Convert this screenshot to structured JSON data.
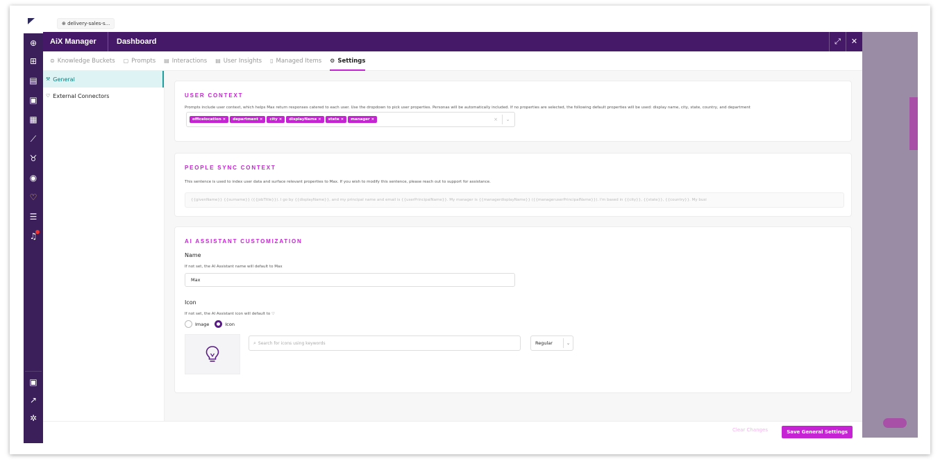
{
  "browser_tab": {
    "label": "delivery-sales-s..."
  },
  "header": {
    "brand": "AiX Manager",
    "title": "Dashboard",
    "expand_label": "⤢",
    "close_label": "✕"
  },
  "nav_tabs": [
    {
      "label": "Knowledge Buckets",
      "icon": "bucket-icon"
    },
    {
      "label": "Prompts",
      "icon": "prompt-icon"
    },
    {
      "label": "Interactions",
      "icon": "interactions-icon"
    },
    {
      "label": "User Insights",
      "icon": "user-insights-icon"
    },
    {
      "label": "Managed Items",
      "icon": "managed-items-icon"
    },
    {
      "label": "Settings",
      "icon": "gear-icon",
      "active": true
    }
  ],
  "sidebar": {
    "items": [
      {
        "label": "General",
        "icon": "wrench-icon",
        "active": true
      },
      {
        "label": "External Connectors",
        "icon": "shield-icon",
        "active": false
      }
    ]
  },
  "user_context": {
    "title": "USER CONTEXT",
    "description": "Prompts include user context, which helps Max return responses catered to each user. Use the dropdown to pick user properties. Personas will be automatically included. If no properties are selected, the following default properties will be used: display name, city, state, country, and department",
    "selected": [
      "officelocation",
      "department",
      "city",
      "displayName",
      "state",
      "manager"
    ]
  },
  "people_sync": {
    "title": "PEOPLE SYNC CONTEXT",
    "description": "This sentence is used to index user data and surface relevant properties to Max. If you wish to modify this sentence, please reach out to support for assistance.",
    "sentence": "{{givenName}} {{surname}} ({{jobTitle}}). I go by {{displayName}}, and my principal name and email is {{userPrincipalName}}. My manager is {{managerdisplayName}} ({{manageruserPrincipalName}}). I'm based in {{city}}, {{state}}, {{country}}. My busi"
  },
  "assistant": {
    "title": "AI ASSISTANT CUSTOMIZATION",
    "name_label": "Name",
    "name_hint": "If not set, the AI Assistant name will default to Max",
    "name_value": "Max",
    "icon_label": "Icon",
    "icon_hint": "If not set, the AI Assistant icon will default to",
    "radio_image": "Image",
    "radio_icon": "Icon",
    "selected_radio": "Icon",
    "search_placeholder": "Search for icons using keywords",
    "style_value": "Regular",
    "preview_icon": "lightbulb-icon"
  },
  "footer": {
    "clear_label": "Clear Changes",
    "save_label": "Save General Settings"
  },
  "colors": {
    "rail": "#3a1f5a",
    "header": "#451868",
    "accent": "#c623d4",
    "active_side": "#def3f4"
  }
}
